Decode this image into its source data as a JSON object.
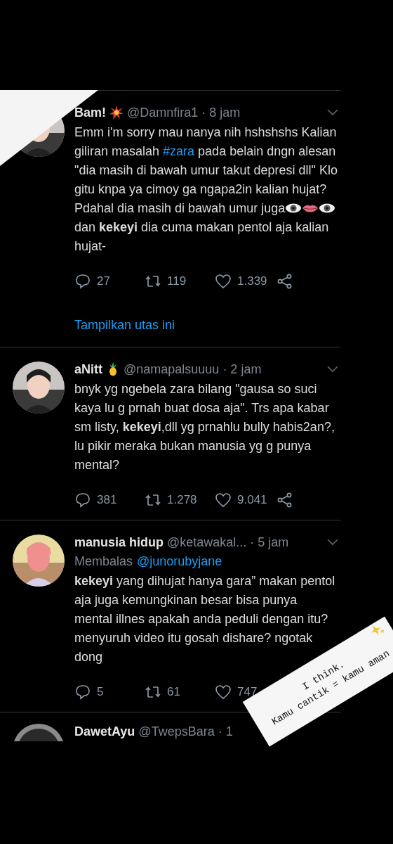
{
  "tweets": [
    {
      "name": "Bam!",
      "badge": {
        "kind": "burst"
      },
      "handle": "@Damnfira1",
      "time": "· 8 jam",
      "body": [
        {
          "kind": "text",
          "text": "Emm i'm sorry mau nanya nih hshshshs Kalian giliran masalah "
        },
        {
          "kind": "hashtag",
          "text": "#zara"
        },
        {
          "kind": "text",
          "text": " pada belain dngn alesan \"dia masih di bawah umur takut depresi dll\" Klo gitu knpa ya cimoy ga ngapa2in kalian hujat? Pdahal dia masih di bawah umur juga"
        },
        {
          "kind": "eye-emoji"
        },
        {
          "kind": "lips-emoji"
        },
        {
          "kind": "eye-emoji"
        },
        {
          "kind": "text",
          "text": "dan **kekeyi** dia cuma makan pentol aja kalian hujat-"
        }
      ],
      "replies": "27",
      "retweets": "119",
      "likes": "1.339",
      "share_visible": true,
      "thread_link": "Tampilkan utas ini"
    },
    {
      "name": "aNitt",
      "badge": {
        "kind": "pineapple"
      },
      "handle": "@namapalsuuuu",
      "time": "· 2 jam",
      "body": [
        {
          "kind": "text",
          "text": "bnyk yg ngebela zara bilang \"gausa so suci kaya lu g prnah buat dosa aja\". Trs apa kabar sm listy, **kekeyi**,dll yg prnahlu bully habis2an?, lu pikir meraka bukan manusia yg g punya mental?"
        }
      ],
      "replies": "381",
      "retweets": "1.278",
      "likes": "9.041",
      "share_visible": true
    },
    {
      "name": "manusia hidup",
      "handle": "@ketawakal...",
      "time": "· 5 jam",
      "reply_label": "Membalas",
      "reply_to": "@junorubyjane",
      "body": [
        {
          "kind": "text",
          "text": "**kekeyi** yang dihujat hanya gara” makan pentol aja juga kemungkinan besar bisa punya mental illnes apakah anda peduli dengan itu? menyuruh video itu gosah dishare? ngotak dong"
        }
      ],
      "replies": "5",
      "retweets": "61",
      "likes": "747",
      "share_visible": false
    }
  ],
  "cut_tweet": {
    "name": "DawetAyu",
    "handle": "@TwepsBara · 1"
  },
  "sticker": {
    "line_1": "I think.",
    "line_2": "Kamu cantik = kamu aman"
  }
}
